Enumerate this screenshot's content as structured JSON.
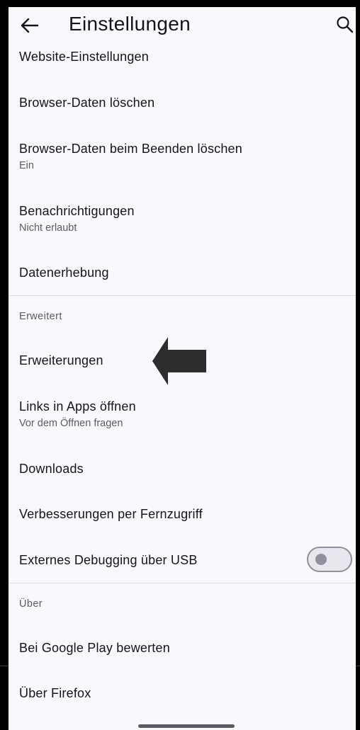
{
  "header": {
    "title": "Einstellungen",
    "back_icon": "arrow-left-icon",
    "search_icon": "search-icon"
  },
  "items": {
    "website_settings": {
      "title": "Website-Einstellungen"
    },
    "clear_data": {
      "title": "Browser-Daten löschen"
    },
    "clear_on_exit": {
      "title": "Browser-Daten beim Beenden löschen",
      "subtitle": "Ein"
    },
    "notifications": {
      "title": "Benachrichtigungen",
      "subtitle": "Nicht erlaubt"
    },
    "data_collection": {
      "title": "Datenerhebung"
    },
    "addons": {
      "title": "Erweiterungen"
    },
    "open_links": {
      "title": "Links in Apps öffnen",
      "subtitle": "Vor dem Öffnen fragen"
    },
    "downloads": {
      "title": "Downloads"
    },
    "remote_improvements": {
      "title": "Verbesserungen per Fernzugriff"
    },
    "usb_debugging": {
      "title": "Externes Debugging über USB",
      "toggle_on": false
    },
    "rate_play": {
      "title": "Bei Google Play bewerten"
    },
    "about_firefox": {
      "title": "Über Firefox"
    }
  },
  "sections": {
    "advanced": "Erweitert",
    "about": "Über"
  },
  "annotation": {
    "icon": "arrow-pointer-icon",
    "color": "#2d2d2d"
  },
  "colors": {
    "background": "#f9f8fd",
    "text_primary": "#15141a",
    "text_secondary": "#5b5b66",
    "divider": "#dcdbe0"
  }
}
